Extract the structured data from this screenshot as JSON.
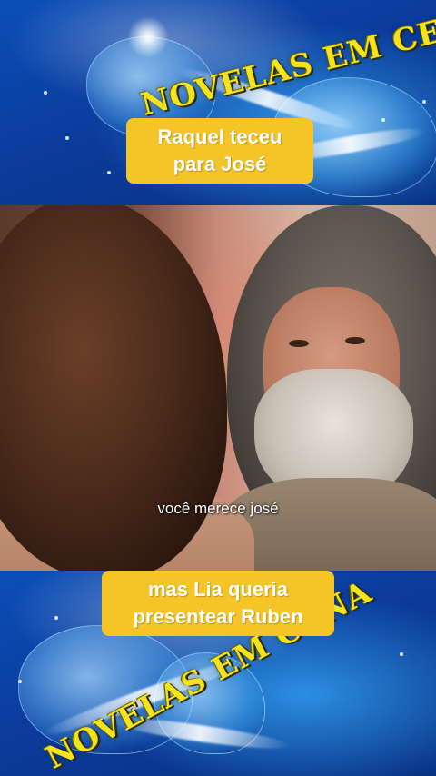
{
  "banner": {
    "logo_text": "NOVELAS EM CENA"
  },
  "captions": {
    "top": [
      "Raquel teceu",
      "para José"
    ],
    "bottom": [
      "mas Lia queria",
      "presentear Ruben"
    ]
  },
  "video": {
    "subtitle": "você merece josé"
  },
  "colors": {
    "caption_bg": "#f5c528",
    "logo_yellow": "#f3e21c",
    "banner_blue": "#0b3c9c"
  }
}
